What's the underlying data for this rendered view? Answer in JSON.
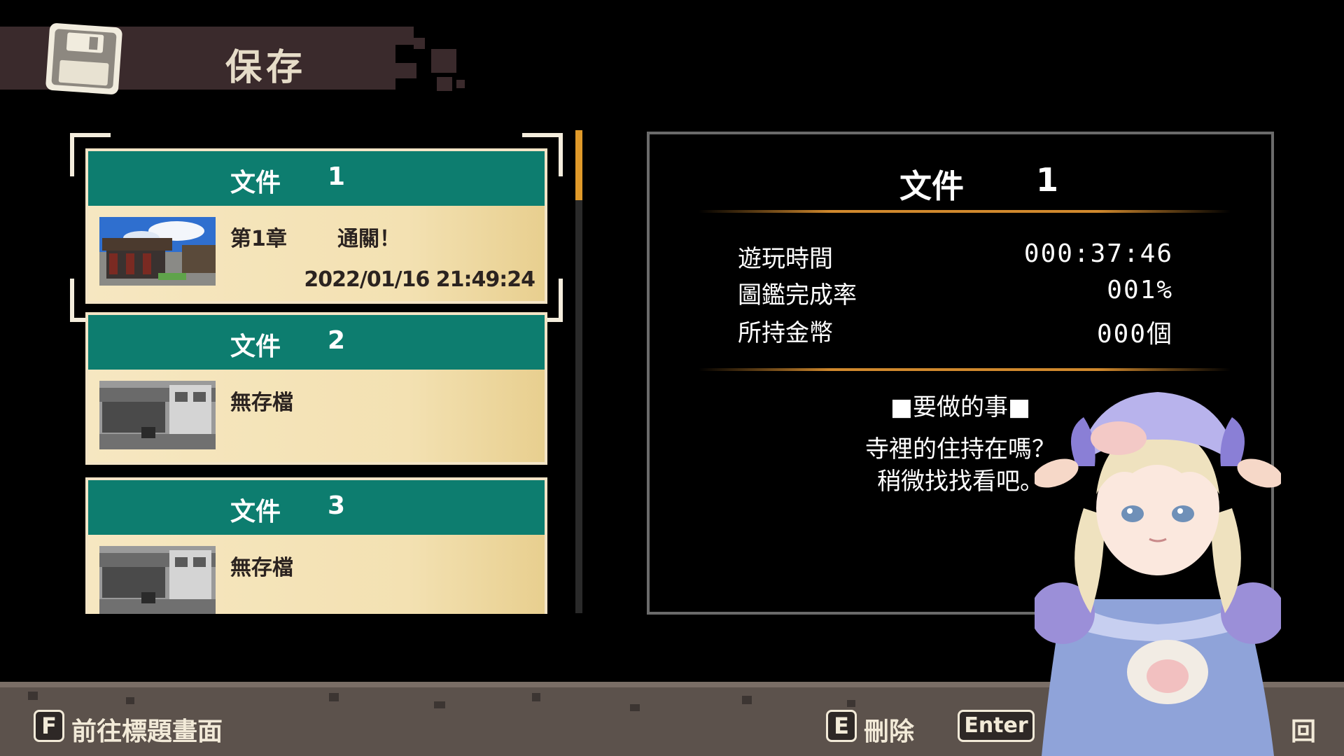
{
  "header": {
    "title": "保存",
    "icon": "floppy-disk-icon"
  },
  "slots": [
    {
      "label": "文件",
      "number": "1",
      "line1": "第1章",
      "status": "通關！",
      "date": "2022/01/16 21:49:24",
      "selected": true
    },
    {
      "label": "文件",
      "number": "2",
      "line1": "無存檔",
      "status": "",
      "date": ""
    },
    {
      "label": "文件",
      "number": "3",
      "line1": "無存檔",
      "status": "",
      "date": ""
    }
  ],
  "detail": {
    "title": "文件",
    "number": "1",
    "stats": [
      {
        "label": "遊玩時間",
        "value": "000:37:46"
      },
      {
        "label": "圖鑑完成率",
        "value": "001%"
      },
      {
        "label": "所持金幣",
        "value": "000個"
      }
    ],
    "todo_header": "■要做的事■",
    "todo_lines": [
      "寺裡的住持在嗎？",
      "稍微找找看吧。"
    ]
  },
  "controls": {
    "title_key": "F",
    "title_label": "前往標題畫面",
    "delete_key": "E",
    "delete_label": "刪除",
    "confirm_key": "Enter",
    "back_label": "回"
  },
  "colors": {
    "slot_header": "#0d7d6f",
    "slot_body": "#f3e1b2",
    "accent_rule": "#d1892d",
    "scrollbar": "#e09a2a",
    "header_band": "#3a2a2c"
  }
}
